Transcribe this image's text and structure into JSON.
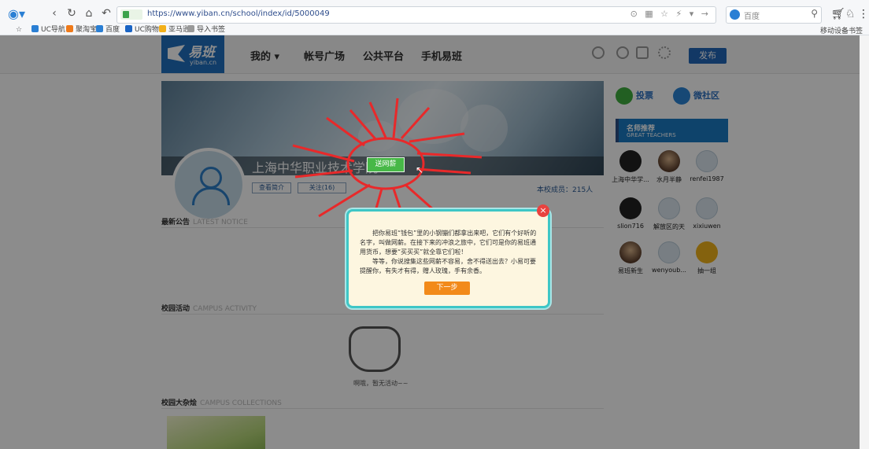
{
  "browser": {
    "url": "https://www.yiban.cn/school/index/id/5000049",
    "search_engine_label": "百度",
    "bookmarks": [
      "UC导航",
      "聚淘宝",
      "百度",
      "UC购物",
      "亚马逊",
      "导入书签"
    ],
    "bookmarks_right": "移动设备书签"
  },
  "site": {
    "logo_text": "易班",
    "logo_sub": "yiban.cn",
    "menu": [
      "我的 ▾",
      "帐号广场",
      "公共平台",
      "手机易班"
    ],
    "publish_label": "发布"
  },
  "school": {
    "name": "上海中华职业技术学院",
    "gift_button": "送网薪",
    "intro_button": "查看简介",
    "follow_button": "关注(16)",
    "members": "本校成员：215人"
  },
  "sections": {
    "notice": {
      "cn": "最新公告",
      "en": "LATEST NOTICE"
    },
    "activity": {
      "cn": "校园活动",
      "en": "CAMPUS ACTIVITY"
    },
    "empty_activity": "啊哦，暂无活动~~",
    "collections": {
      "cn": "校园大杂烩",
      "en": "CAMPUS COLLECTIONS"
    }
  },
  "sidebar": {
    "vote_label": "投票",
    "community_label": "微社区",
    "teachers_cn": "名师推荐",
    "teachers_en": "GREAT TEACHERS",
    "people": [
      "上海中华学...",
      "水月半静",
      "renfei1987",
      "slion716",
      "解放区的天",
      "xixiuwen",
      "易班新生",
      "wenyoub...",
      "抽一组"
    ]
  },
  "popup": {
    "paragraph1": "把你易班“钱包”里的小钢镚们都拿出来吧，它们有个好听的名字，叫做网薪。在接下来的冲浪之旅中，它们可是你的易班通用货币，想要“买买买”就全靠它们啦！",
    "paragraph2": "等等，你说搜集这些网薪不容易，舍不得送出去？小易可要提醒你，有失才有得，赠人玫瑰，手有余香。",
    "next_button": "下一步",
    "close": "×"
  },
  "colors": {
    "brand_blue": "#1f6fbf",
    "popup_border": "#3ec6c6",
    "next_orange": "#f28a1a",
    "gift_green": "#47b847",
    "arrow_red": "#e8292a"
  }
}
